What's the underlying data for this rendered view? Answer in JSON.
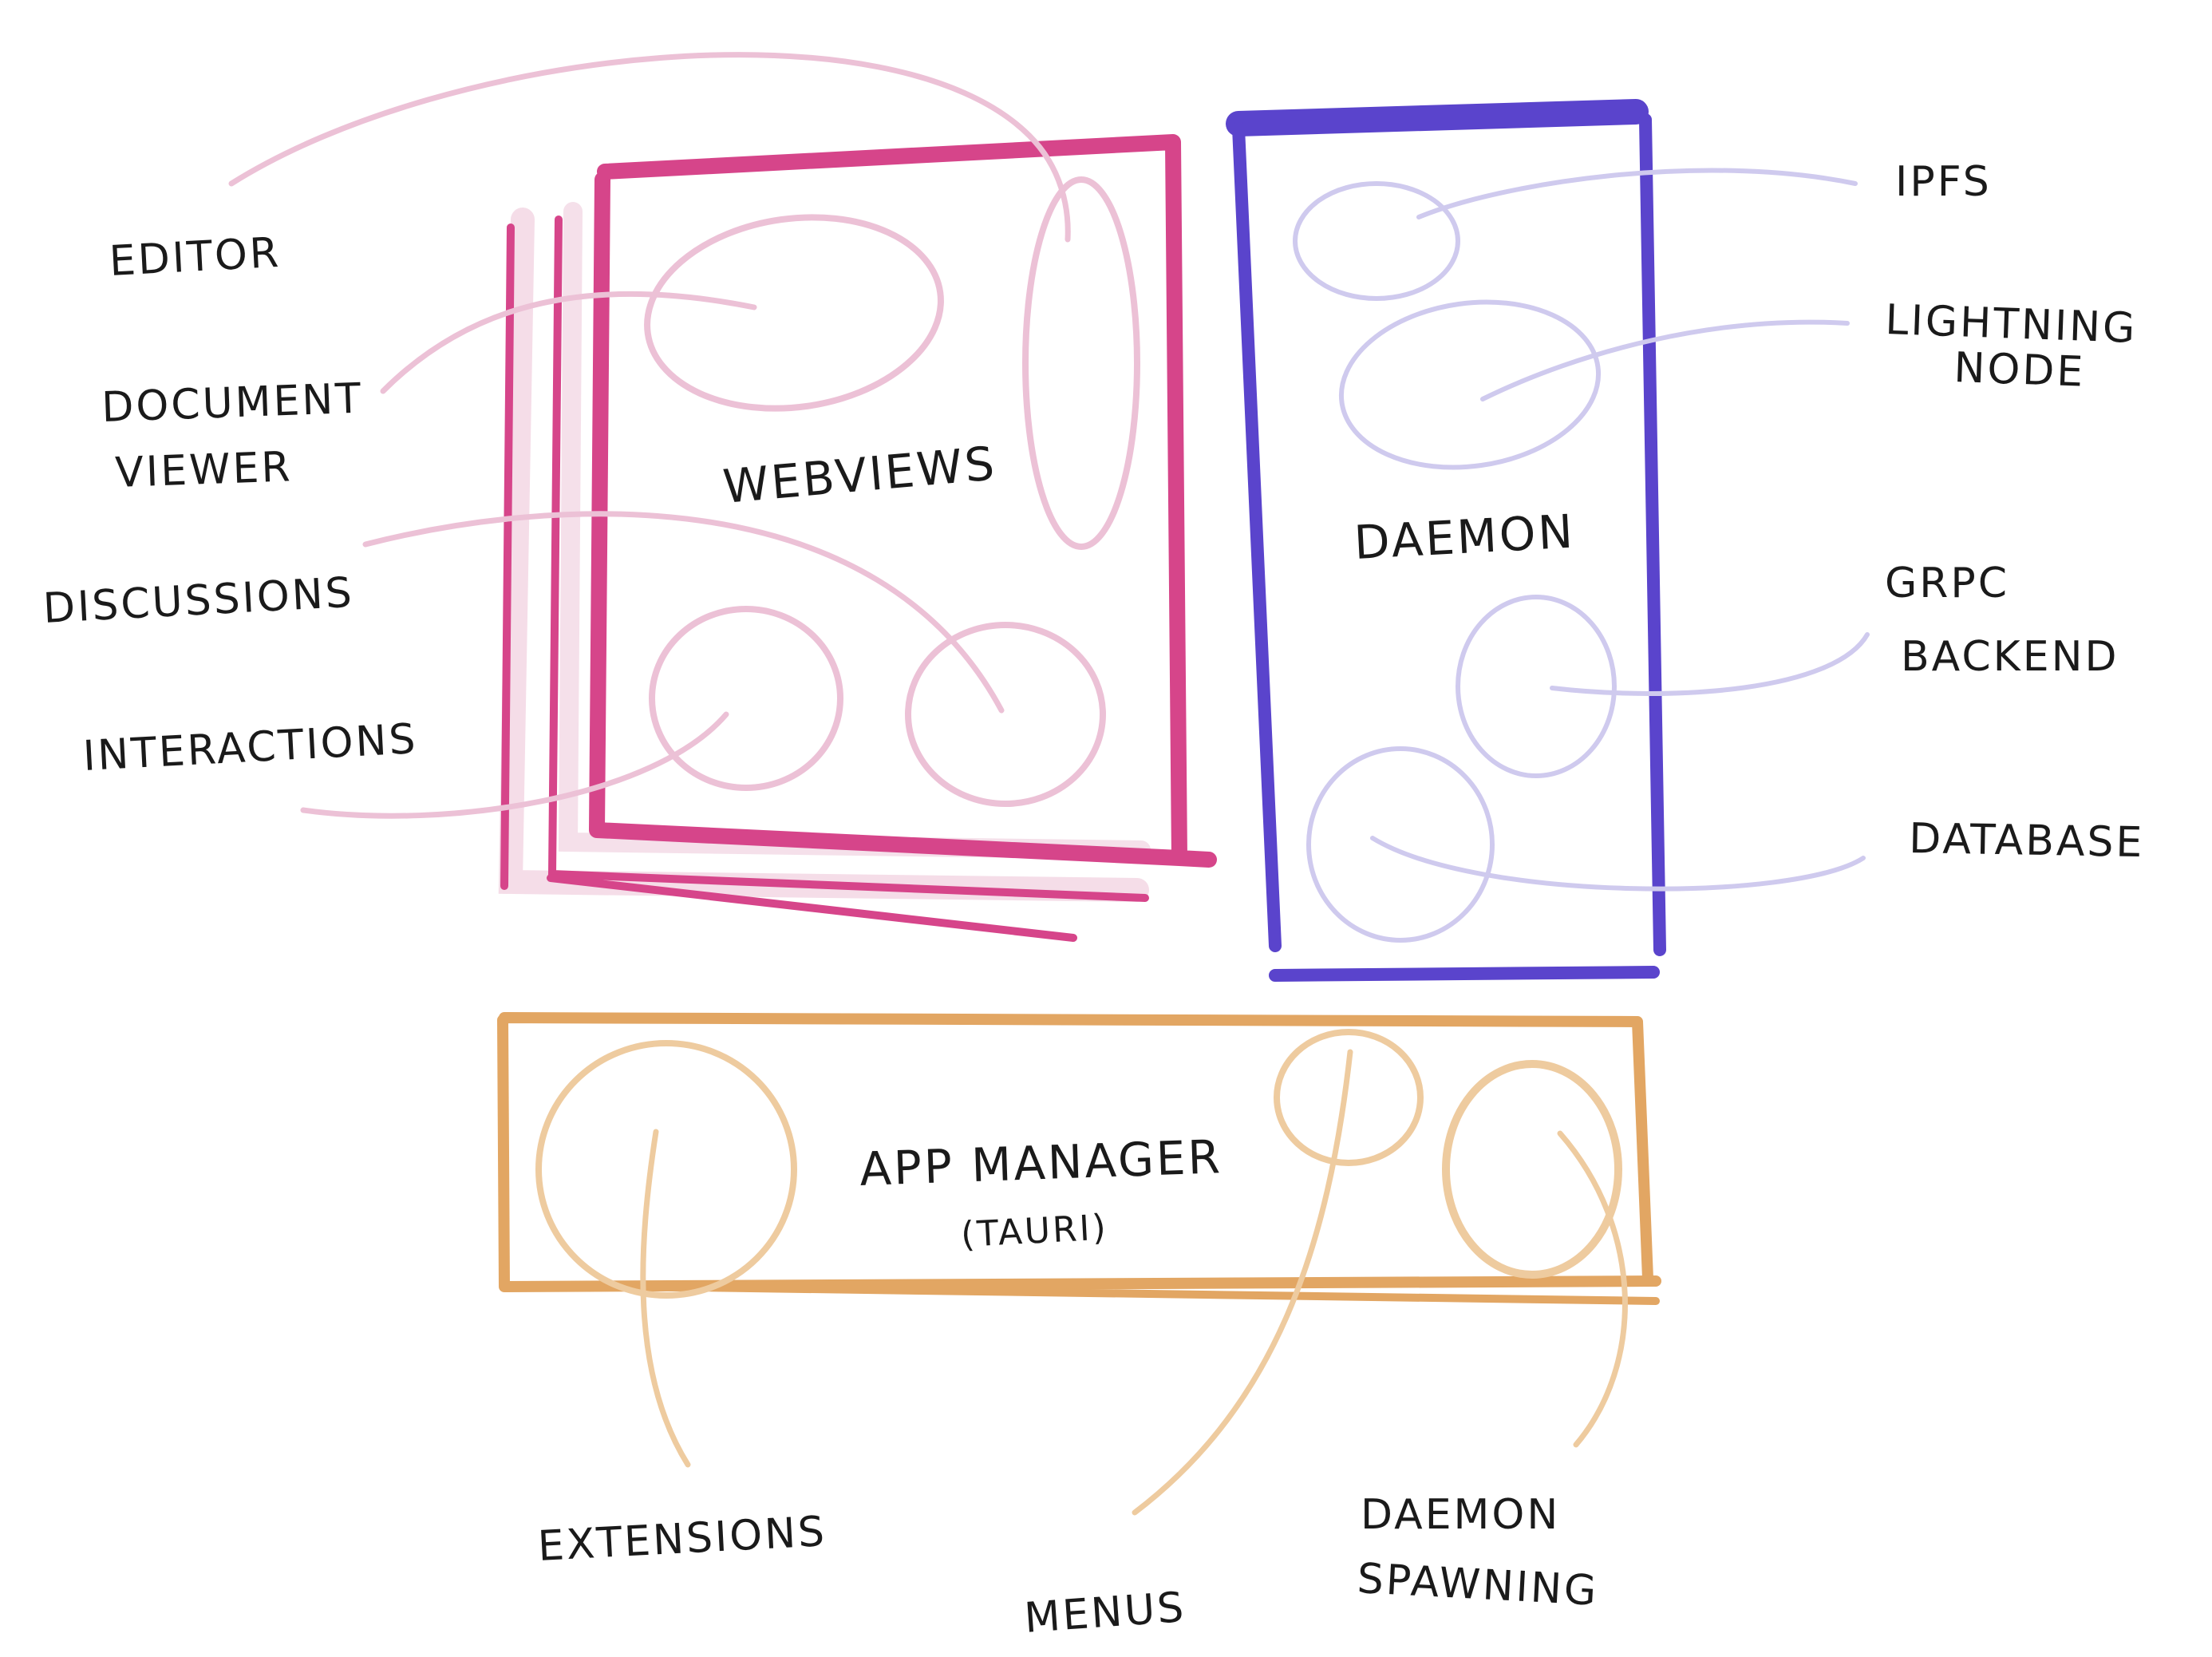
{
  "colors": {
    "webviews": "#d6458a",
    "webviews_light": "#ecc1d6",
    "daemon": "#5a44cc",
    "daemon_light": "#cfcaee",
    "app_manager": "#e2a663",
    "app_manager_light": "#eecb9f",
    "ink": "#1a1a1a"
  },
  "labels": {
    "webviews": "WEBVIEWS",
    "daemon": "DAEMON",
    "app_manager": "APP   MANAGER",
    "app_manager_sub": "(TAURI)",
    "editor": "EDITOR",
    "document_viewer_line1": "DOCUMENT",
    "document_viewer_line2": "VIEWER",
    "discussions": "DISCUSSIONS",
    "interactions": "INTERACTIONS",
    "ipfs": "IPFS",
    "lightning_node_line1": "LIGHTNING",
    "lightning_node_line2": "NODE",
    "grpc_backend_line1": "GRPC",
    "grpc_backend_line2": "BACKEND",
    "database": "DATABASE",
    "extensions": "EXTENSIONS",
    "menus": "MENUS",
    "daemon_spawning_line1": "DAEMON",
    "daemon_spawning_line2": "SPAWNING"
  }
}
